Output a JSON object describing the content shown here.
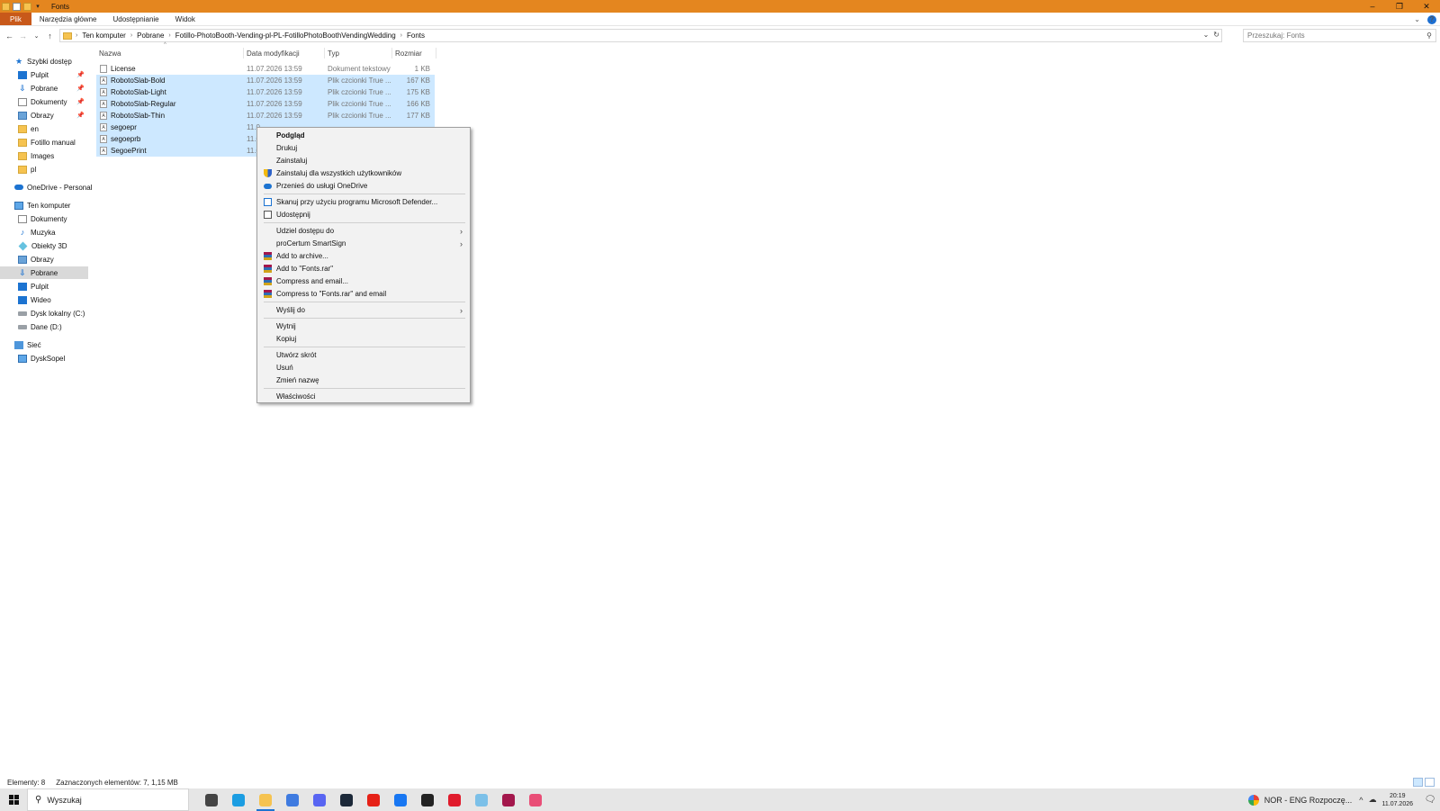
{
  "window": {
    "title": "Fonts",
    "controls": {
      "minimize": "–",
      "maximize": "❐",
      "close": "✕"
    }
  },
  "ribbon": {
    "tabs": [
      "Plik",
      "Narzędzia główne",
      "Udostępnianie",
      "Widok"
    ]
  },
  "address": {
    "crumbs": [
      "Ten komputer",
      "Pobrane",
      "Fotillo-PhotoBooth-Vending-pl-PL-FotilloPhotoBoothVendingWedding",
      "Fonts"
    ],
    "search_placeholder": "Przeszukaj: Fonts"
  },
  "nav": {
    "items": [
      {
        "label": "Szybki dostęp",
        "icon": "star-icon"
      },
      {
        "label": "Pulpit",
        "icon": "desktop-icon",
        "pinned": true
      },
      {
        "label": "Pobrane",
        "icon": "download-icon",
        "pinned": true
      },
      {
        "label": "Dokumenty",
        "icon": "documents-icon",
        "pinned": true
      },
      {
        "label": "Obrazy",
        "icon": "pictures-icon",
        "pinned": true
      },
      {
        "label": "en",
        "icon": "folder-icon"
      },
      {
        "label": "Fotillo manual",
        "icon": "folder-icon"
      },
      {
        "label": "Images",
        "icon": "folder-icon"
      },
      {
        "label": "pl",
        "icon": "folder-icon"
      },
      {
        "label": "OneDrive - Personal",
        "icon": "onedrive-icon"
      },
      {
        "label": "Ten komputer",
        "icon": "computer-icon"
      },
      {
        "label": "Dokumenty",
        "icon": "documents-icon"
      },
      {
        "label": "Muzyka",
        "icon": "music-icon"
      },
      {
        "label": "Obiekty 3D",
        "icon": "3d-objects-icon"
      },
      {
        "label": "Obrazy",
        "icon": "pictures-icon"
      },
      {
        "label": "Pobrane",
        "icon": "download-icon",
        "selected": true
      },
      {
        "label": "Pulpit",
        "icon": "desktop-icon"
      },
      {
        "label": "Wideo",
        "icon": "video-icon"
      },
      {
        "label": "Dysk lokalny (C:)",
        "icon": "drive-icon"
      },
      {
        "label": "Dane (D:)",
        "icon": "drive-icon"
      },
      {
        "label": "Sieć",
        "icon": "network-icon"
      },
      {
        "label": "DyskSopel",
        "icon": "computer-icon"
      }
    ]
  },
  "columns": {
    "name": "Nazwa",
    "date": "Data modyfikacji",
    "type": "Typ",
    "size": "Rozmiar"
  },
  "files": [
    {
      "name": "License",
      "date": "11.07.2026 13:59",
      "type": "Dokument tekstowy",
      "size": "1 KB",
      "selected": false
    },
    {
      "name": "RobotoSlab-Bold",
      "date": "11.07.2026 13:59",
      "type": "Plik czcionki True ...",
      "size": "167 KB",
      "selected": true
    },
    {
      "name": "RobotoSlab-Light",
      "date": "11.07.2026 13:59",
      "type": "Plik czcionki True ...",
      "size": "175 KB",
      "selected": true
    },
    {
      "name": "RobotoSlab-Regular",
      "date": "11.07.2026 13:59",
      "type": "Plik czcionki True ...",
      "size": "166 KB",
      "selected": true
    },
    {
      "name": "RobotoSlab-Thin",
      "date": "11.07.2026 13:59",
      "type": "Plik czcionki True ...",
      "size": "177 KB",
      "selected": true
    },
    {
      "name": "segoepr",
      "date": "11.0",
      "type": "",
      "size": "",
      "selected": true
    },
    {
      "name": "segoeprb",
      "date": "11.0",
      "type": "",
      "size": "",
      "selected": true
    },
    {
      "name": "SegoePrint",
      "date": "11.0",
      "type": "",
      "size": "",
      "selected": true
    }
  ],
  "context_menu": {
    "groups": [
      [
        {
          "label": "Podgląd",
          "bold": true
        },
        {
          "label": "Drukuj"
        },
        {
          "label": "Zainstaluj"
        },
        {
          "label": "Zainstaluj dla wszystkich użytkowników",
          "icon": "shield-icon"
        },
        {
          "label": "Przenieś do usługi OneDrive",
          "icon": "onedrive-icon"
        }
      ],
      [
        {
          "label": "Skanuj przy użyciu programu Microsoft Defender...",
          "icon": "defender-icon"
        },
        {
          "label": "Udostępnij",
          "icon": "share-icon"
        }
      ],
      [
        {
          "label": "Udziel dostępu do",
          "submenu": true
        },
        {
          "label": "proCertum SmartSign",
          "submenu": true
        },
        {
          "label": "Add to archive...",
          "icon": "winrar-icon"
        },
        {
          "label": "Add to \"Fonts.rar\"",
          "icon": "winrar-icon"
        },
        {
          "label": "Compress and email...",
          "icon": "winrar-icon"
        },
        {
          "label": "Compress to \"Fonts.rar\" and email",
          "icon": "winrar-icon"
        }
      ],
      [
        {
          "label": "Wyślij do",
          "submenu": true
        }
      ],
      [
        {
          "label": "Wytnij"
        },
        {
          "label": "Kopiuj"
        }
      ],
      [
        {
          "label": "Utwórz skrót"
        },
        {
          "label": "Usuń"
        },
        {
          "label": "Zmień nazwę"
        }
      ],
      [
        {
          "label": "Właściwości"
        }
      ]
    ]
  },
  "status": {
    "count": "Elementy: 8",
    "selection": "Zaznaczonych elementów: 7, 1,15 MB"
  },
  "taskbar": {
    "search_placeholder": "Wyszukaj",
    "apps": [
      {
        "name": "task-view-icon",
        "color": "#444444"
      },
      {
        "name": "edge-icon",
        "color": "#1b9de2"
      },
      {
        "name": "file-explorer-icon",
        "color": "#f6c350",
        "active": true
      },
      {
        "name": "chrome-icon",
        "color": "#3f7be0"
      },
      {
        "name": "discord-icon",
        "color": "#5865f2"
      },
      {
        "name": "steam-icon",
        "color": "#1b2838"
      },
      {
        "name": "youtube-icon",
        "color": "#e62117"
      },
      {
        "name": "facebook-icon",
        "color": "#1877f2"
      },
      {
        "name": "amazon-icon",
        "color": "#222222"
      },
      {
        "name": "opera-icon",
        "color": "#e01b2c"
      },
      {
        "name": "paint-icon",
        "color": "#7cc0e8"
      },
      {
        "name": "winrar-icon",
        "color": "#a3174c"
      },
      {
        "name": "snipping-icon",
        "color": "#e94e77"
      }
    ],
    "language": "NOR - ENG Rozpoczę...",
    "time": "20:19",
    "date": "11.07.2026"
  },
  "colors": {
    "titlebar": "#e4861f",
    "file_tab": "#c8591a",
    "selection": "#cde8ff",
    "accent": "#1c73d1"
  }
}
